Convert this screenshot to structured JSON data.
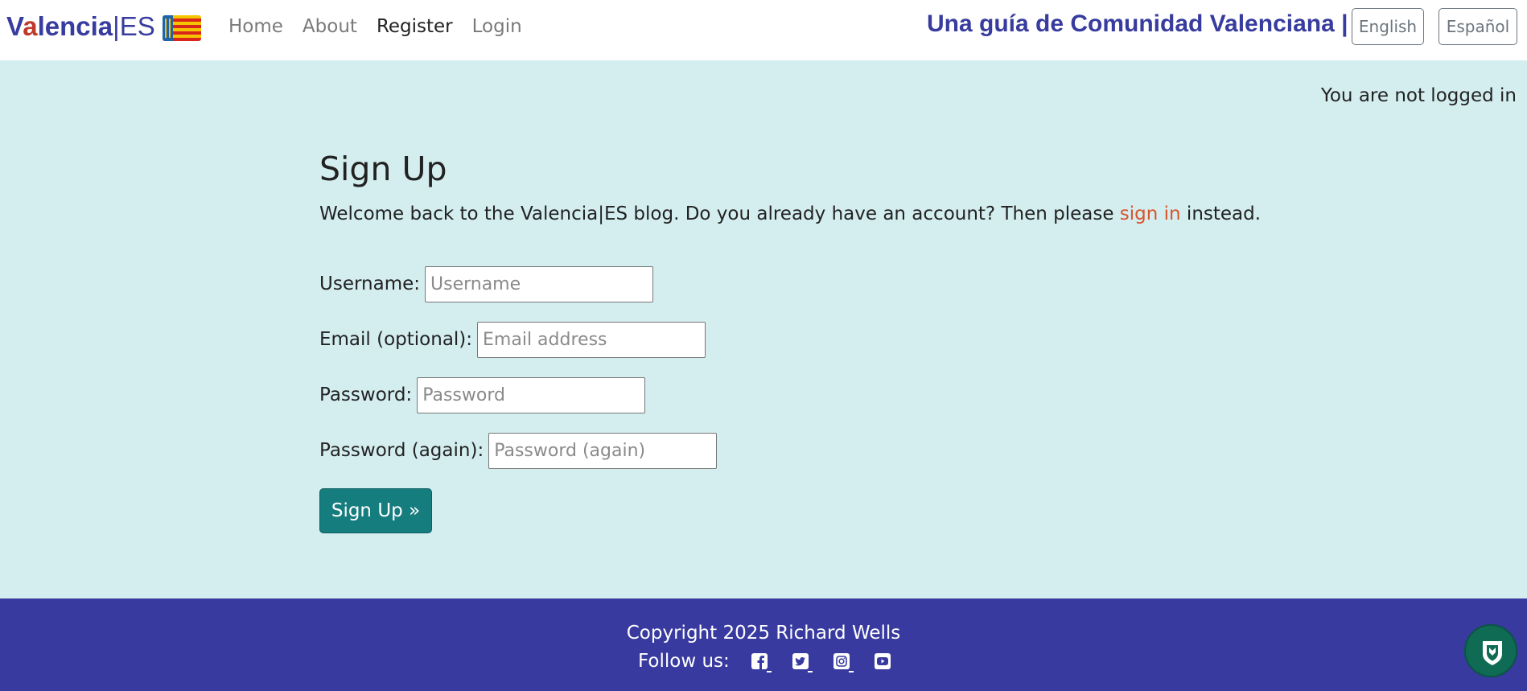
{
  "brand": {
    "part1": "V",
    "part_a": "a",
    "part2": "lencia",
    "separator": "|",
    "part3": "ES"
  },
  "nav": {
    "home": "Home",
    "about": "About",
    "register": "Register",
    "login": "Login"
  },
  "header": {
    "tagline": "Una guía de Comunidad Valenciana  |",
    "lang_en": "English",
    "lang_es": "Español"
  },
  "status": {
    "login_text": "You are not logged in"
  },
  "signup": {
    "title": "Sign Up",
    "intro_before": "Welcome back to the Valencia|ES blog. Do you already have an account? Then please ",
    "intro_link": "sign in",
    "intro_after": " instead.",
    "fields": [
      {
        "label": "Username:",
        "placeholder": "Username",
        "value": ""
      },
      {
        "label": "Email (optional):",
        "placeholder": "Email address",
        "value": ""
      },
      {
        "label": "Password:",
        "placeholder": "Password",
        "value": ""
      },
      {
        "label": "Password (again):",
        "placeholder": "Password (again)",
        "value": ""
      }
    ],
    "submit_label": "Sign Up »"
  },
  "footer": {
    "copyright": "Copyright 2025 Richard Wells",
    "follow_label": "Follow us:",
    "social_icons": [
      "facebook-icon",
      "twitter-icon",
      "instagram-icon",
      "youtube-icon"
    ]
  },
  "colors": {
    "brand_blue": "#383c9e",
    "page_background": "#d4eef0",
    "button_teal": "#167d7f",
    "link_orange": "#d9532c",
    "footer_background": "#383a9f",
    "badge_green": "#106b54"
  }
}
